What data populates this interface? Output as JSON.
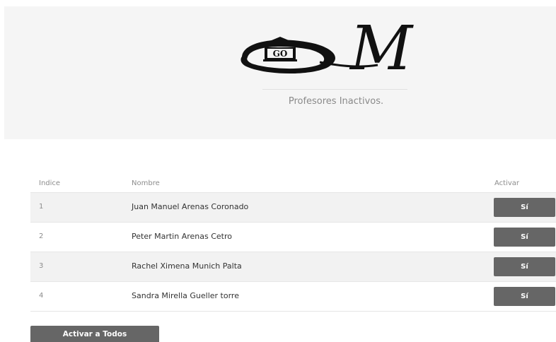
{
  "header": {
    "subtitle": "Profesores Inactivos.",
    "logo": {
      "monogram": "M",
      "badge_text": "GO",
      "icon": "building-icon"
    }
  },
  "table": {
    "headers": {
      "index": "Indice",
      "name": "Nombre",
      "activate": "Activar"
    },
    "rows": [
      {
        "index": "1",
        "name": "Juan Manuel Arenas Coronado",
        "button": "Sí"
      },
      {
        "index": "2",
        "name": "Peter Martin Arenas Cetro",
        "button": "Sí"
      },
      {
        "index": "3",
        "name": "Rachel Ximena Munich Palta",
        "button": "Sí"
      },
      {
        "index": "4",
        "name": "Sandra Mirella Gueller torre",
        "button": "Sí"
      }
    ]
  },
  "actions": {
    "activate_all": "Activar a Todos"
  },
  "colors": {
    "button_bg": "#666666",
    "header_bg": "#f5f5f5",
    "row_alt_bg": "#f2f2f2"
  }
}
